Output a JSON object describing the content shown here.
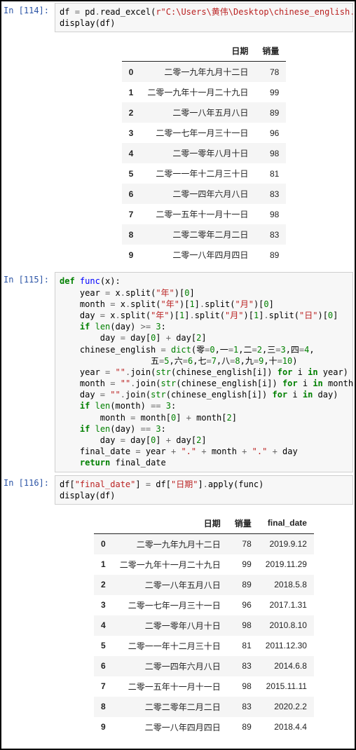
{
  "cells": [
    {
      "prompt": "In [114]:",
      "code_html": "df <span class='tok-op'>=</span> pd<span class='tok-op'>.</span>read_excel(<span class='tok-str'>r\"C:\\Users\\黄伟\\Desktop\\chinese_english.xlsx\"</span>\ndisplay(df)",
      "output_table": {
        "columns": [
          "日期",
          "销量"
        ],
        "rows": [
          [
            "0",
            "二零一九年九月十二日",
            "78"
          ],
          [
            "1",
            "二零一九年十一月二十九日",
            "99"
          ],
          [
            "2",
            "二零一八年五月八日",
            "89"
          ],
          [
            "3",
            "二零一七年一月三十一日",
            "96"
          ],
          [
            "4",
            "二零一零年八月十日",
            "98"
          ],
          [
            "5",
            "二零一一年十二月三十日",
            "81"
          ],
          [
            "6",
            "二零一四年六月八日",
            "83"
          ],
          [
            "7",
            "二零一五年十一月十一日",
            "98"
          ],
          [
            "8",
            "二零二零年二月二日",
            "83"
          ],
          [
            "9",
            "二零一八年四月四日",
            "89"
          ]
        ]
      }
    },
    {
      "prompt": "In [115]:",
      "code_html": "<span class='tok-kw'>def</span> <span class='tok-fn'>func</span>(x):\n    year <span class='tok-op'>=</span> x<span class='tok-op'>.</span>split(<span class='tok-str'>\"年\"</span>)[<span class='tok-num'>0</span>]\n    month <span class='tok-op'>=</span> x<span class='tok-op'>.</span>split(<span class='tok-str'>\"年\"</span>)[<span class='tok-num'>1</span>]<span class='tok-op'>.</span>split(<span class='tok-str'>\"月\"</span>)[<span class='tok-num'>0</span>]\n    day <span class='tok-op'>=</span> x<span class='tok-op'>.</span>split(<span class='tok-str'>\"年\"</span>)[<span class='tok-num'>1</span>]<span class='tok-op'>.</span>split(<span class='tok-str'>\"月\"</span>)[<span class='tok-num'>1</span>]<span class='tok-op'>.</span>split(<span class='tok-str'>\"日\"</span>)[<span class='tok-num'>0</span>]\n    <span class='tok-kw'>if</span> <span class='tok-bi'>len</span>(day) <span class='tok-op'>&gt;=</span> <span class='tok-num'>3</span>:\n        day <span class='tok-op'>=</span> day[<span class='tok-num'>0</span>] <span class='tok-op'>+</span> day[<span class='tok-num'>2</span>]\n    chinese_english <span class='tok-op'>=</span> <span class='tok-bi'>dict</span>(零<span class='tok-op'>=</span><span class='tok-num'>0</span>,一<span class='tok-op'>=</span><span class='tok-num'>1</span>,二<span class='tok-op'>=</span><span class='tok-num'>2</span>,三<span class='tok-op'>=</span><span class='tok-num'>3</span>,四<span class='tok-op'>=</span><span class='tok-num'>4</span>,\n                  五<span class='tok-op'>=</span><span class='tok-num'>5</span>,六<span class='tok-op'>=</span><span class='tok-num'>6</span>,七<span class='tok-op'>=</span><span class='tok-num'>7</span>,八<span class='tok-op'>=</span><span class='tok-num'>8</span>,九<span class='tok-op'>=</span><span class='tok-num'>9</span>,十<span class='tok-op'>=</span><span class='tok-num'>10</span>)\n    year <span class='tok-op'>=</span> <span class='tok-str'>\"\"</span><span class='tok-op'>.</span>join(<span class='tok-bi'>str</span>(chinese_english[i]) <span class='tok-kw'>for</span> i <span class='tok-kw'>in</span> year)\n    month <span class='tok-op'>=</span> <span class='tok-str'>\"\"</span><span class='tok-op'>.</span>join(<span class='tok-bi'>str</span>(chinese_english[i]) <span class='tok-kw'>for</span> i <span class='tok-kw'>in</span> month)\n    day <span class='tok-op'>=</span> <span class='tok-str'>\"\"</span><span class='tok-op'>.</span>join(<span class='tok-bi'>str</span>(chinese_english[i]) <span class='tok-kw'>for</span> i <span class='tok-kw'>in</span> day)\n    <span class='tok-kw'>if</span> <span class='tok-bi'>len</span>(month) <span class='tok-op'>==</span> <span class='tok-num'>3</span>:\n        month <span class='tok-op'>=</span> month[<span class='tok-num'>0</span>] <span class='tok-op'>+</span> month[<span class='tok-num'>2</span>]\n    <span class='tok-kw'>if</span> <span class='tok-bi'>len</span>(day) <span class='tok-op'>==</span> <span class='tok-num'>3</span>:\n        day <span class='tok-op'>=</span> day[<span class='tok-num'>0</span>] <span class='tok-op'>+</span> day[<span class='tok-num'>2</span>]\n    final_date <span class='tok-op'>=</span> year <span class='tok-op'>+</span> <span class='tok-str'>\".\"</span> <span class='tok-op'>+</span> month <span class='tok-op'>+</span> <span class='tok-str'>\".\"</span> <span class='tok-op'>+</span> day\n    <span class='tok-kw'>return</span> final_date"
    },
    {
      "prompt": "In [116]:",
      "code_html": "df[<span class='tok-str'>\"final_date\"</span>] <span class='tok-op'>=</span> df[<span class='tok-str'>\"日期\"</span>]<span class='tok-op'>.</span>apply(func)\ndisplay(df)",
      "output_table": {
        "columns": [
          "日期",
          "销量",
          "final_date"
        ],
        "rows": [
          [
            "0",
            "二零一九年九月十二日",
            "78",
            "2019.9.12"
          ],
          [
            "1",
            "二零一九年十一月二十九日",
            "99",
            "2019.11.29"
          ],
          [
            "2",
            "二零一八年五月八日",
            "89",
            "2018.5.8"
          ],
          [
            "3",
            "二零一七年一月三十一日",
            "96",
            "2017.1.31"
          ],
          [
            "4",
            "二零一零年八月十日",
            "98",
            "2010.8.10"
          ],
          [
            "5",
            "二零一一年十二月三十日",
            "81",
            "2011.12.30"
          ],
          [
            "6",
            "二零一四年六月八日",
            "83",
            "2014.6.8"
          ],
          [
            "7",
            "二零一五年十一月十一日",
            "98",
            "2015.11.11"
          ],
          [
            "8",
            "二零二零年二月二日",
            "83",
            "2020.2.2"
          ],
          [
            "9",
            "二零一八年四月四日",
            "89",
            "2018.4.4"
          ]
        ]
      }
    }
  ]
}
